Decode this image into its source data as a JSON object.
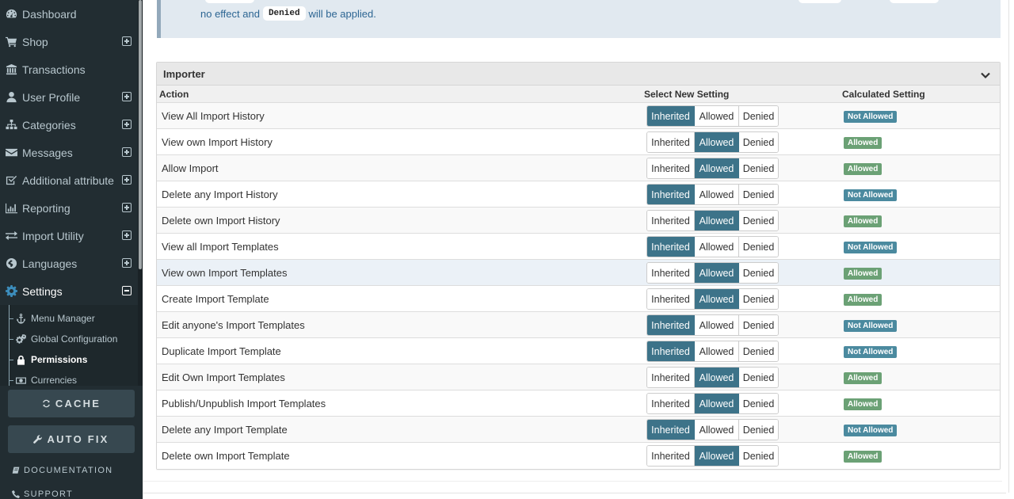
{
  "sidebar": {
    "items": [
      {
        "label": "Dashboard",
        "icon": "dashboard-icon",
        "expandable": false
      },
      {
        "label": "Shop",
        "icon": "cart-icon",
        "expandable": true
      },
      {
        "label": "Transactions",
        "icon": "bank-icon",
        "expandable": false
      },
      {
        "label": "User Profile",
        "icon": "user-icon",
        "expandable": true
      },
      {
        "label": "Categories",
        "icon": "sitemap-icon",
        "expandable": true
      },
      {
        "label": "Messages",
        "icon": "envelope-icon",
        "expandable": true
      },
      {
        "label": "Additional attribute",
        "icon": "checkbox-icon",
        "expandable": true
      },
      {
        "label": "Reporting",
        "icon": "bar-chart-icon",
        "expandable": true
      },
      {
        "label": "Import Utility",
        "icon": "exchange-icon",
        "expandable": true
      },
      {
        "label": "Languages",
        "icon": "globe-icon",
        "expandable": true
      },
      {
        "label": "Settings",
        "icon": "gear-icon",
        "expandable": true,
        "expanded": true
      }
    ],
    "settings_children": [
      {
        "label": "Menu Manager",
        "icon": "anchor-icon"
      },
      {
        "label": "Global Configuration",
        "icon": "cogs-icon"
      },
      {
        "label": "Permissions",
        "icon": "lock-icon",
        "active": true
      },
      {
        "label": "Currencies",
        "icon": "money-icon"
      }
    ],
    "cache_button": "CACHE",
    "autofix_button": "AUTO FIX",
    "documentation_link": "DOCUMENTATION",
    "support_link": "SUPPORT"
  },
  "callout": {
    "text_before": "no effect and",
    "code": "Denied",
    "text_after": "will be applied."
  },
  "panel": {
    "title": "Importer",
    "columns": {
      "action": "Action",
      "select": "Select New Setting",
      "calculated": "Calculated Setting"
    },
    "options": [
      "Inherited",
      "Allowed",
      "Denied"
    ],
    "status_colors": {
      "selected": "#3d7389",
      "not_allowed": "#4b8a9f",
      "allowed": "#6ba175"
    },
    "rows": [
      {
        "action": "View All Import History",
        "selected": "Inherited",
        "calculated": "Not Allowed"
      },
      {
        "action": "View own Import History",
        "selected": "Allowed",
        "calculated": "Allowed"
      },
      {
        "action": "Allow Import",
        "selected": "Allowed",
        "calculated": "Allowed"
      },
      {
        "action": "Delete any Import History",
        "selected": "Inherited",
        "calculated": "Not Allowed"
      },
      {
        "action": "Delete own Import History",
        "selected": "Allowed",
        "calculated": "Allowed"
      },
      {
        "action": "View all Import Templates",
        "selected": "Inherited",
        "calculated": "Not Allowed"
      },
      {
        "action": "View own Import Templates",
        "selected": "Allowed",
        "calculated": "Allowed",
        "hovered": true
      },
      {
        "action": "Create Import Template",
        "selected": "Allowed",
        "calculated": "Allowed"
      },
      {
        "action": "Edit anyone's Import Templates",
        "selected": "Inherited",
        "calculated": "Not Allowed"
      },
      {
        "action": "Duplicate Import Template",
        "selected": "Inherited",
        "calculated": "Not Allowed"
      },
      {
        "action": "Edit Own Import Templates",
        "selected": "Allowed",
        "calculated": "Allowed"
      },
      {
        "action": "Publish/Unpublish Import Templates",
        "selected": "Allowed",
        "calculated": "Allowed"
      },
      {
        "action": "Delete any Import Template",
        "selected": "Inherited",
        "calculated": "Not Allowed"
      },
      {
        "action": "Delete own Import Template",
        "selected": "Allowed",
        "calculated": "Allowed"
      }
    ]
  }
}
